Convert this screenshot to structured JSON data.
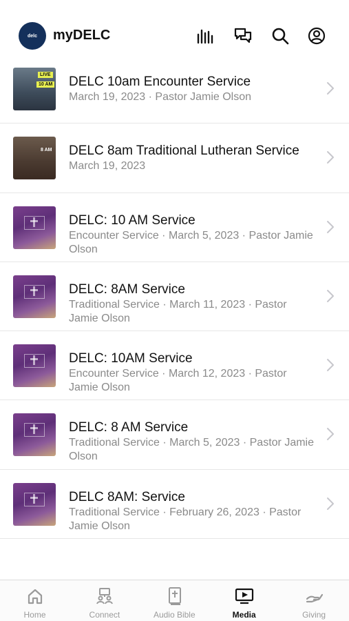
{
  "header": {
    "logo_text": "delc",
    "title": "myDELC",
    "icons": [
      "library-icon",
      "messages-icon",
      "search-icon",
      "profile-icon"
    ]
  },
  "media_items": [
    {
      "title": "DELC 10am Encounter Service",
      "subtitle": "March 19, 2023 · Pastor Jamie Olson",
      "thumb": "live",
      "thumb_badge": "LIVE",
      "thumb_text": "10 AM"
    },
    {
      "title": "DELC 8am Traditional Lutheran Service",
      "subtitle": "March 19, 2023",
      "thumb": "trad",
      "thumb_text": "8 AM"
    },
    {
      "title": "DELC: 10 AM Service",
      "subtitle": "Encounter Service · March 5, 2023 · Pastor Jamie Olson",
      "thumb": "purple"
    },
    {
      "title": "DELC: 8AM Service",
      "subtitle": "Traditional Service · March 11, 2023 · Pastor Jamie Olson",
      "thumb": "purple"
    },
    {
      "title": "DELC: 10AM Service",
      "subtitle": "Encounter Service · March 12, 2023 · Pastor Jamie Olson",
      "thumb": "purple"
    },
    {
      "title": "DELC: 8 AM Service",
      "subtitle": "Traditional Service · March 5, 2023 · Pastor Jamie Olson",
      "thumb": "purple"
    },
    {
      "title": "DELC 8AM: Service",
      "subtitle": "Traditional Service · February 26, 2023 · Pastor Jamie Olson",
      "thumb": "purple"
    }
  ],
  "tabs": [
    {
      "label": "Home",
      "icon": "home-icon",
      "active": false
    },
    {
      "label": "Connect",
      "icon": "connect-icon",
      "active": false
    },
    {
      "label": "Audio Bible",
      "icon": "bible-icon",
      "active": false
    },
    {
      "label": "Media",
      "icon": "media-icon",
      "active": true
    },
    {
      "label": "Giving",
      "icon": "giving-icon",
      "active": false
    }
  ],
  "colors": {
    "logo_bg": "#14305b",
    "secondary_text": "#8a8a8a",
    "inactive_tab": "#9a9a9a"
  }
}
